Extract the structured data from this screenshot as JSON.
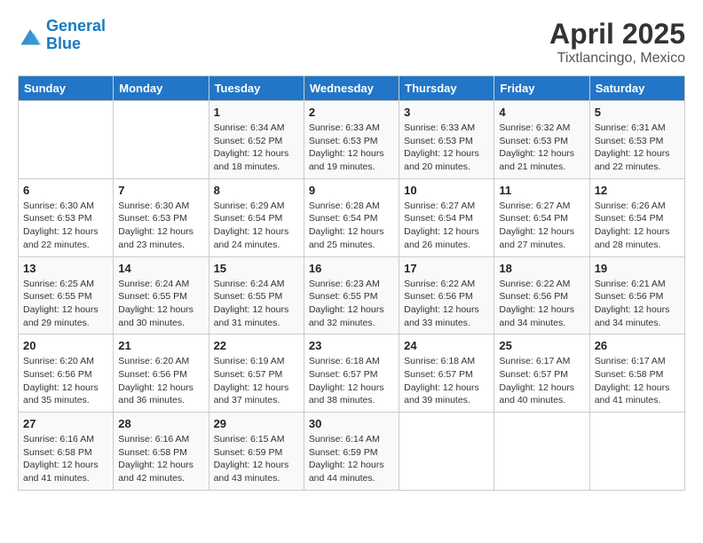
{
  "header": {
    "logo_line1": "General",
    "logo_line2": "Blue",
    "title": "April 2025",
    "subtitle": "Tixtlancingo, Mexico"
  },
  "days_of_week": [
    "Sunday",
    "Monday",
    "Tuesday",
    "Wednesday",
    "Thursday",
    "Friday",
    "Saturday"
  ],
  "weeks": [
    [
      {
        "num": "",
        "sunrise": "",
        "sunset": "",
        "daylight": ""
      },
      {
        "num": "",
        "sunrise": "",
        "sunset": "",
        "daylight": ""
      },
      {
        "num": "1",
        "sunrise": "Sunrise: 6:34 AM",
        "sunset": "Sunset: 6:52 PM",
        "daylight": "Daylight: 12 hours and 18 minutes."
      },
      {
        "num": "2",
        "sunrise": "Sunrise: 6:33 AM",
        "sunset": "Sunset: 6:53 PM",
        "daylight": "Daylight: 12 hours and 19 minutes."
      },
      {
        "num": "3",
        "sunrise": "Sunrise: 6:33 AM",
        "sunset": "Sunset: 6:53 PM",
        "daylight": "Daylight: 12 hours and 20 minutes."
      },
      {
        "num": "4",
        "sunrise": "Sunrise: 6:32 AM",
        "sunset": "Sunset: 6:53 PM",
        "daylight": "Daylight: 12 hours and 21 minutes."
      },
      {
        "num": "5",
        "sunrise": "Sunrise: 6:31 AM",
        "sunset": "Sunset: 6:53 PM",
        "daylight": "Daylight: 12 hours and 22 minutes."
      }
    ],
    [
      {
        "num": "6",
        "sunrise": "Sunrise: 6:30 AM",
        "sunset": "Sunset: 6:53 PM",
        "daylight": "Daylight: 12 hours and 22 minutes."
      },
      {
        "num": "7",
        "sunrise": "Sunrise: 6:30 AM",
        "sunset": "Sunset: 6:53 PM",
        "daylight": "Daylight: 12 hours and 23 minutes."
      },
      {
        "num": "8",
        "sunrise": "Sunrise: 6:29 AM",
        "sunset": "Sunset: 6:54 PM",
        "daylight": "Daylight: 12 hours and 24 minutes."
      },
      {
        "num": "9",
        "sunrise": "Sunrise: 6:28 AM",
        "sunset": "Sunset: 6:54 PM",
        "daylight": "Daylight: 12 hours and 25 minutes."
      },
      {
        "num": "10",
        "sunrise": "Sunrise: 6:27 AM",
        "sunset": "Sunset: 6:54 PM",
        "daylight": "Daylight: 12 hours and 26 minutes."
      },
      {
        "num": "11",
        "sunrise": "Sunrise: 6:27 AM",
        "sunset": "Sunset: 6:54 PM",
        "daylight": "Daylight: 12 hours and 27 minutes."
      },
      {
        "num": "12",
        "sunrise": "Sunrise: 6:26 AM",
        "sunset": "Sunset: 6:54 PM",
        "daylight": "Daylight: 12 hours and 28 minutes."
      }
    ],
    [
      {
        "num": "13",
        "sunrise": "Sunrise: 6:25 AM",
        "sunset": "Sunset: 6:55 PM",
        "daylight": "Daylight: 12 hours and 29 minutes."
      },
      {
        "num": "14",
        "sunrise": "Sunrise: 6:24 AM",
        "sunset": "Sunset: 6:55 PM",
        "daylight": "Daylight: 12 hours and 30 minutes."
      },
      {
        "num": "15",
        "sunrise": "Sunrise: 6:24 AM",
        "sunset": "Sunset: 6:55 PM",
        "daylight": "Daylight: 12 hours and 31 minutes."
      },
      {
        "num": "16",
        "sunrise": "Sunrise: 6:23 AM",
        "sunset": "Sunset: 6:55 PM",
        "daylight": "Daylight: 12 hours and 32 minutes."
      },
      {
        "num": "17",
        "sunrise": "Sunrise: 6:22 AM",
        "sunset": "Sunset: 6:56 PM",
        "daylight": "Daylight: 12 hours and 33 minutes."
      },
      {
        "num": "18",
        "sunrise": "Sunrise: 6:22 AM",
        "sunset": "Sunset: 6:56 PM",
        "daylight": "Daylight: 12 hours and 34 minutes."
      },
      {
        "num": "19",
        "sunrise": "Sunrise: 6:21 AM",
        "sunset": "Sunset: 6:56 PM",
        "daylight": "Daylight: 12 hours and 34 minutes."
      }
    ],
    [
      {
        "num": "20",
        "sunrise": "Sunrise: 6:20 AM",
        "sunset": "Sunset: 6:56 PM",
        "daylight": "Daylight: 12 hours and 35 minutes."
      },
      {
        "num": "21",
        "sunrise": "Sunrise: 6:20 AM",
        "sunset": "Sunset: 6:56 PM",
        "daylight": "Daylight: 12 hours and 36 minutes."
      },
      {
        "num": "22",
        "sunrise": "Sunrise: 6:19 AM",
        "sunset": "Sunset: 6:57 PM",
        "daylight": "Daylight: 12 hours and 37 minutes."
      },
      {
        "num": "23",
        "sunrise": "Sunrise: 6:18 AM",
        "sunset": "Sunset: 6:57 PM",
        "daylight": "Daylight: 12 hours and 38 minutes."
      },
      {
        "num": "24",
        "sunrise": "Sunrise: 6:18 AM",
        "sunset": "Sunset: 6:57 PM",
        "daylight": "Daylight: 12 hours and 39 minutes."
      },
      {
        "num": "25",
        "sunrise": "Sunrise: 6:17 AM",
        "sunset": "Sunset: 6:57 PM",
        "daylight": "Daylight: 12 hours and 40 minutes."
      },
      {
        "num": "26",
        "sunrise": "Sunrise: 6:17 AM",
        "sunset": "Sunset: 6:58 PM",
        "daylight": "Daylight: 12 hours and 41 minutes."
      }
    ],
    [
      {
        "num": "27",
        "sunrise": "Sunrise: 6:16 AM",
        "sunset": "Sunset: 6:58 PM",
        "daylight": "Daylight: 12 hours and 41 minutes."
      },
      {
        "num": "28",
        "sunrise": "Sunrise: 6:16 AM",
        "sunset": "Sunset: 6:58 PM",
        "daylight": "Daylight: 12 hours and 42 minutes."
      },
      {
        "num": "29",
        "sunrise": "Sunrise: 6:15 AM",
        "sunset": "Sunset: 6:59 PM",
        "daylight": "Daylight: 12 hours and 43 minutes."
      },
      {
        "num": "30",
        "sunrise": "Sunrise: 6:14 AM",
        "sunset": "Sunset: 6:59 PM",
        "daylight": "Daylight: 12 hours and 44 minutes."
      },
      {
        "num": "",
        "sunrise": "",
        "sunset": "",
        "daylight": ""
      },
      {
        "num": "",
        "sunrise": "",
        "sunset": "",
        "daylight": ""
      },
      {
        "num": "",
        "sunrise": "",
        "sunset": "",
        "daylight": ""
      }
    ]
  ]
}
